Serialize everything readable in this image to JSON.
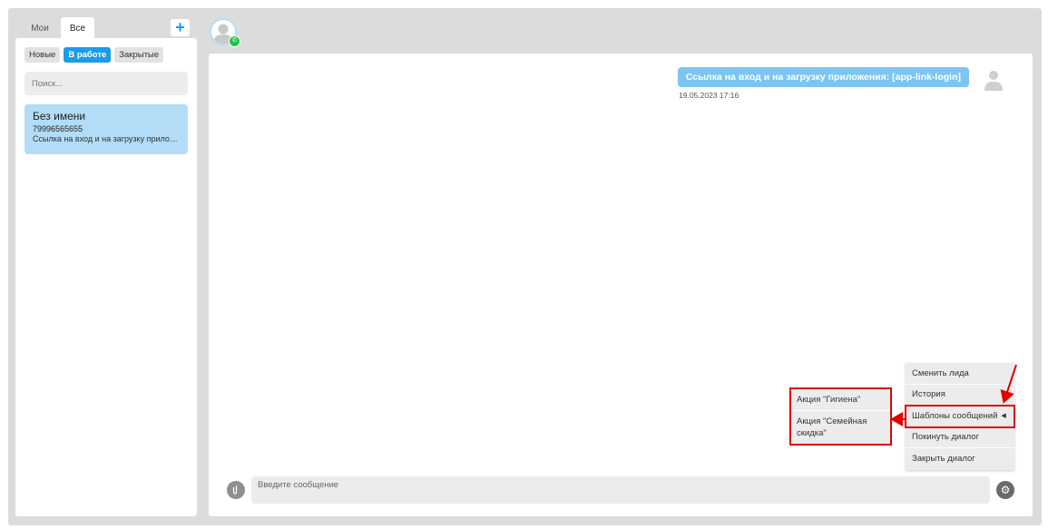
{
  "sidebar": {
    "tabs": [
      {
        "label": "Мои",
        "active": false
      },
      {
        "label": "Все",
        "active": true
      }
    ],
    "add_label": "+",
    "filters": [
      {
        "label": "Новые",
        "active": false
      },
      {
        "label": "В работе",
        "active": true
      },
      {
        "label": "Закрытые",
        "active": false
      }
    ],
    "search_placeholder": "Поиск...",
    "dialogs": [
      {
        "name": "Без имени",
        "phone": "79996565655",
        "preview": "Ссылка на вход и на загрузку приложения: [app-link-login]"
      }
    ]
  },
  "chat": {
    "messages": [
      {
        "text": "Ссылка на вход и на загрузку приложения: [app-link-login]",
        "time": "19.05.2023 17:16"
      }
    ],
    "input_placeholder": "Введите сообщение",
    "context_menu": [
      {
        "label": "Сменить лида"
      },
      {
        "label": "История"
      },
      {
        "label": "Шаблоны сообщений",
        "has_submenu": true
      },
      {
        "label": "Покинуть диалог"
      },
      {
        "label": "Закрыть диалог"
      }
    ],
    "submenu": [
      {
        "label": "Акция \"Гигиена\""
      },
      {
        "label": "Акция \"Семейная скидка\""
      }
    ]
  },
  "icons": {
    "header_avatar": "user-avatar-icon",
    "channel_badge": "whatsapp-icon",
    "attach": "attach-icon",
    "settings": "gear-icon"
  },
  "colors": {
    "accent": "#1e9be8",
    "bubble": "#7cc4f2",
    "selected_dialog": "#b3dcf7",
    "annotation": "#e00000",
    "whatsapp": "#25c24a"
  }
}
